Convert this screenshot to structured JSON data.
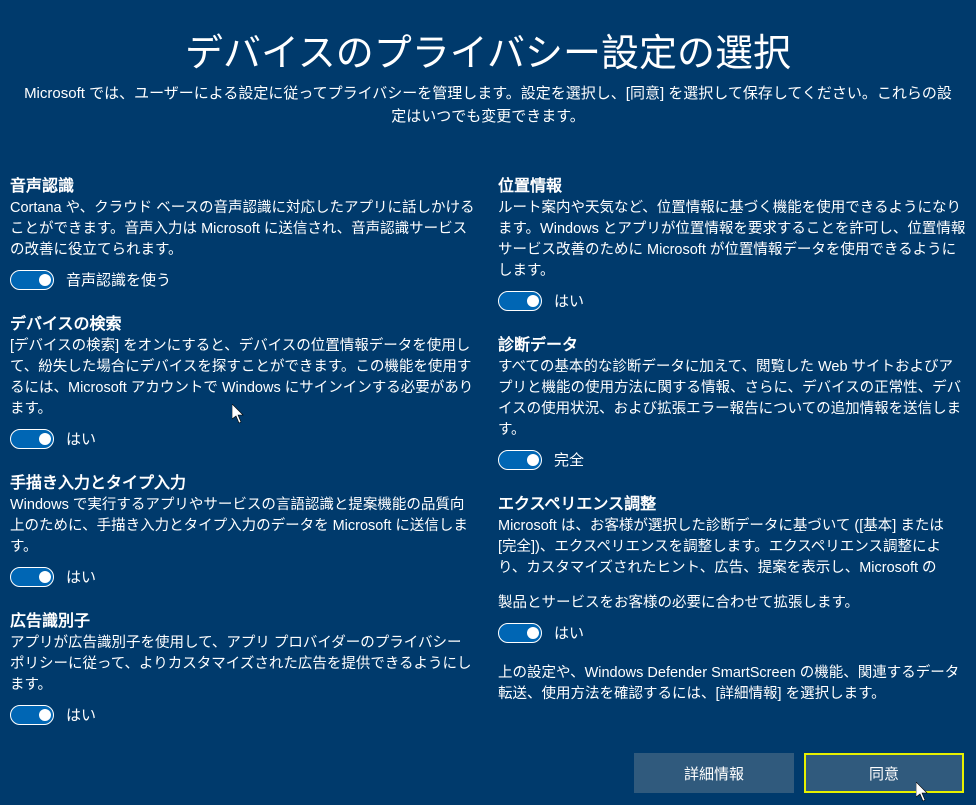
{
  "header": {
    "title": "デバイスのプライバシー設定の選択",
    "subtitle": "Microsoft では、ユーザーによる設定に従ってプライバシーを管理します。設定を選択し、[同意] を選択して保存してください。これらの設定はいつでも変更できます。"
  },
  "left": {
    "speech": {
      "title": "音声認識",
      "desc": "Cortana や、クラウド ベースの音声認識に対応したアプリに話しかけることができます。音声入力は Microsoft に送信され、音声認識サービスの改善に役立てられます。",
      "label": "音声認識を使う"
    },
    "findDevice": {
      "title": "デバイスの検索",
      "desc": "[デバイスの検索] をオンにすると、デバイスの位置情報データを使用して、紛失した場合にデバイスを探すことができます。この機能を使用するには、Microsoft アカウントで Windows にサインインする必要があります。",
      "label": "はい"
    },
    "inking": {
      "title": "手描き入力とタイプ入力",
      "desc": "Windows で実行するアプリやサービスの言語認識と提案機能の品質向上のために、手描き入力とタイプ入力のデータを Microsoft に送信します。",
      "label": "はい"
    },
    "adId": {
      "title": "広告識別子",
      "desc": "アプリが広告識別子を使用して、アプリ プロバイダーのプライバシー ポリシーに従って、よりカスタマイズされた広告を提供できるようにします。",
      "label": "はい"
    }
  },
  "right": {
    "location": {
      "title": "位置情報",
      "desc": "ルート案内や天気など、位置情報に基づく機能を使用できるようになります。Windows とアプリが位置情報を要求することを許可し、位置情報サービス改善のために Microsoft が位置情報データを使用できるようにします。",
      "label": "はい"
    },
    "diagnostic": {
      "title": "診断データ",
      "desc": "すべての基本的な診断データに加えて、閲覧した Web サイトおよびアプリと機能の使用方法に関する情報、さらに、デバイスの正常性、デバイスの使用状況、および拡張エラー報告についての追加情報を送信します。",
      "label": "完全"
    },
    "tailored": {
      "title": "エクスペリエンス調整",
      "desc": "Microsoft は、お客様が選択した診断データに基づいて ([基本] または [完全])、エクスペリエンスを調整します。エクスペリエンス調整により、カスタマイズされたヒント、広告、提案を表示し、Microsoft の",
      "extra": "製品とサービスをお客様の必要に合わせて拡張します。",
      "label": "はい"
    },
    "note": "上の設定や、Windows Defender SmartScreen の機能、関連するデータ転送、使用方法を確認するには、[詳細情報] を選択します。"
  },
  "footer": {
    "more": "詳細情報",
    "accept": "同意"
  }
}
